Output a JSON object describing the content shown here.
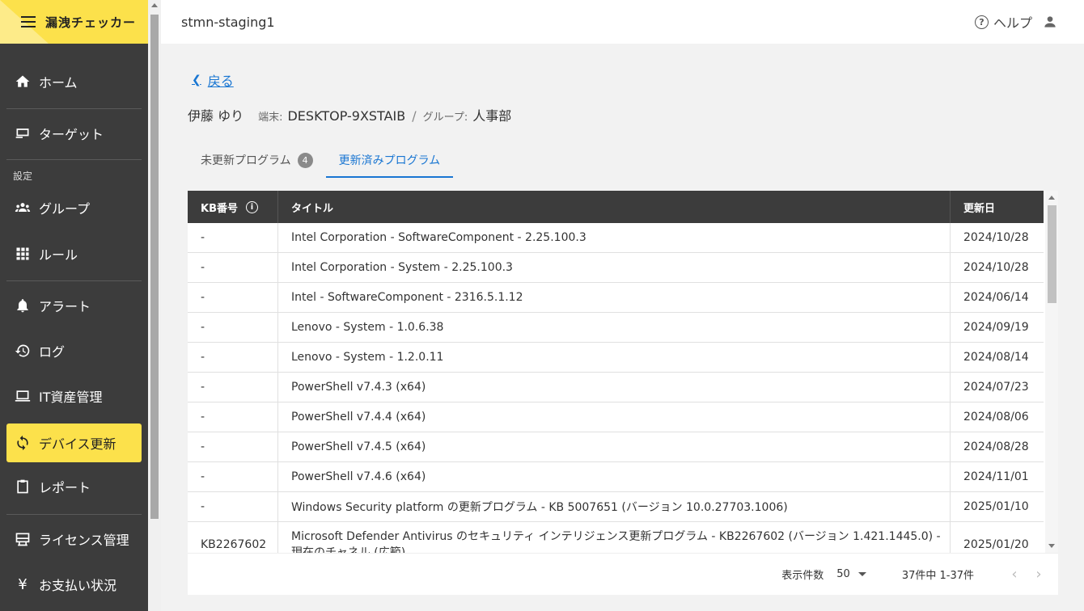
{
  "app": {
    "title": "漏洩チェッカー"
  },
  "topbar": {
    "environment": "stmn-staging1",
    "help_label": "ヘルプ"
  },
  "sidebar": {
    "section_label": "設定",
    "items": [
      {
        "label": "ホーム",
        "icon": "home-icon"
      },
      {
        "label": "ターゲット",
        "icon": "monitor-icon"
      },
      {
        "label": "グループ",
        "icon": "group-icon"
      },
      {
        "label": "ルール",
        "icon": "grid-icon"
      },
      {
        "label": "アラート",
        "icon": "bell-icon"
      },
      {
        "label": "ログ",
        "icon": "history-icon"
      },
      {
        "label": "IT資産管理",
        "icon": "laptop-icon"
      },
      {
        "label": "デバイス更新",
        "icon": "sync-icon",
        "active": true
      },
      {
        "label": "レポート",
        "icon": "clipboard-icon"
      },
      {
        "label": "ライセンス管理",
        "icon": "license-icon"
      },
      {
        "label": "お支払い状況",
        "icon": "yen-icon"
      }
    ]
  },
  "back": {
    "label": "戻る"
  },
  "person": {
    "name": "伊藤 ゆり",
    "terminal_label": "端末:",
    "terminal": "DESKTOP-9XSTAIB",
    "separator": "/",
    "group_label": "グループ:",
    "group": "人事部"
  },
  "tabs": [
    {
      "label": "未更新プログラム",
      "badge": "4"
    },
    {
      "label": "更新済みプログラム",
      "active": true
    }
  ],
  "table": {
    "headers": {
      "kb": "KB番号",
      "title": "タイトル",
      "date": "更新日"
    },
    "rows": [
      {
        "kb": "-",
        "title": "Intel Corporation - SoftwareComponent - 2.25.100.3",
        "date": "2024/10/28"
      },
      {
        "kb": "-",
        "title": "Intel Corporation - System - 2.25.100.3",
        "date": "2024/10/28"
      },
      {
        "kb": "-",
        "title": "Intel - SoftwareComponent - 2316.5.1.12",
        "date": "2024/06/14"
      },
      {
        "kb": "-",
        "title": "Lenovo - System - 1.0.6.38",
        "date": "2024/09/19"
      },
      {
        "kb": "-",
        "title": "Lenovo - System - 1.2.0.11",
        "date": "2024/08/14"
      },
      {
        "kb": "-",
        "title": "PowerShell v7.4.3 (x64)",
        "date": "2024/07/23"
      },
      {
        "kb": "-",
        "title": "PowerShell v7.4.4 (x64)",
        "date": "2024/08/06"
      },
      {
        "kb": "-",
        "title": "PowerShell v7.4.5 (x64)",
        "date": "2024/08/28"
      },
      {
        "kb": "-",
        "title": "PowerShell v7.4.6 (x64)",
        "date": "2024/11/01"
      },
      {
        "kb": "-",
        "title": "Windows Security platform の更新プログラム - KB 5007651 (バージョン 10.0.27703.1006)",
        "date": "2025/01/10"
      },
      {
        "kb": "KB2267602",
        "title": "Microsoft Defender Antivirus のセキュリティ インテリジェンス更新プログラム - KB2267602 (バージョン 1.421.1445.0) - 現在のチャネル (広範)",
        "date": "2025/01/20"
      }
    ]
  },
  "pagination": {
    "per_page_label": "表示件数",
    "per_page_value": "50",
    "range_text": "37件中 1-37件",
    "prev": "‹",
    "next": "›"
  }
}
